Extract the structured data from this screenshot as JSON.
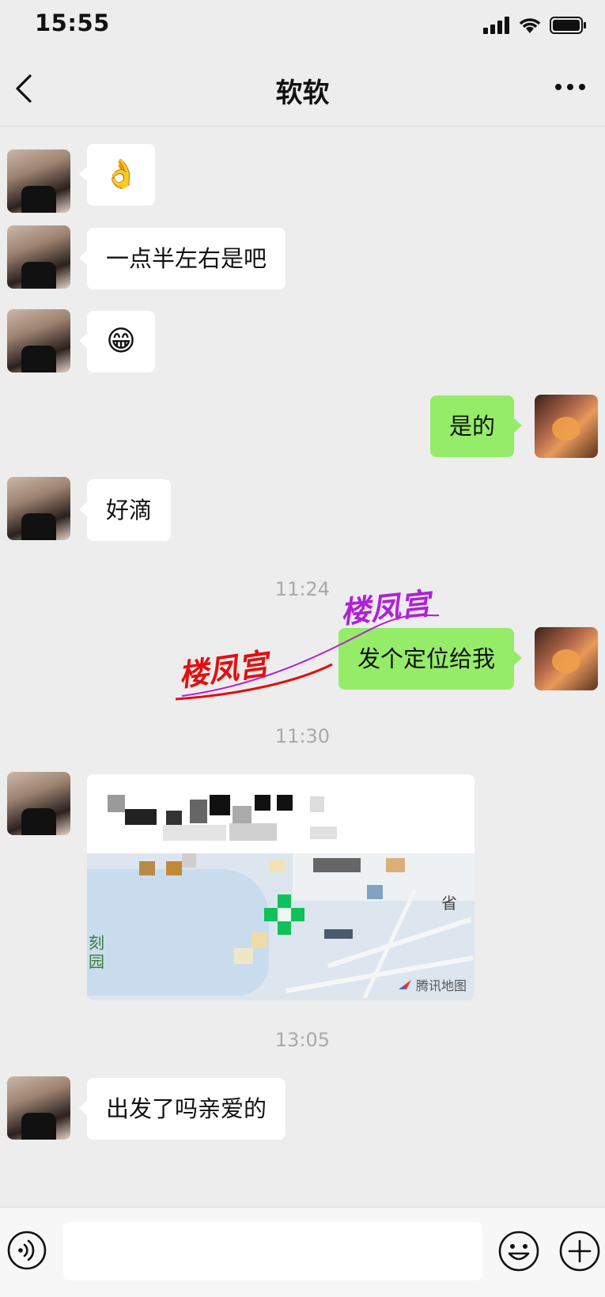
{
  "status_bar": {
    "time": "15:55"
  },
  "header": {
    "title": "软软"
  },
  "messages": [
    {
      "side": "left",
      "kind": "emoji",
      "text": "👌"
    },
    {
      "side": "left",
      "kind": "text",
      "text": "一点半左右是吧"
    },
    {
      "side": "left",
      "kind": "emoji",
      "text": "😁"
    },
    {
      "side": "right",
      "kind": "text",
      "text": "是的"
    },
    {
      "side": "left",
      "kind": "text",
      "text": "好滴"
    },
    {
      "kind": "timestamp",
      "text": "11:24"
    },
    {
      "side": "right",
      "kind": "text",
      "text": "发个定位给我"
    },
    {
      "kind": "timestamp",
      "text": "11:30"
    },
    {
      "side": "left",
      "kind": "location",
      "map_labels": [
        "刻",
        "园"
      ],
      "map_side_label": "省",
      "map_brand": "腾讯地图"
    },
    {
      "kind": "timestamp",
      "text": "13:05"
    },
    {
      "side": "left",
      "kind": "text",
      "text": "出发了吗亲爱的"
    }
  ],
  "watermark": {
    "text_red": "楼凤宫",
    "text_purple": "楼凤宫",
    "color_red": "#e01010",
    "color_purple": "#b020d8"
  },
  "input": {
    "value": "",
    "placeholder": ""
  },
  "colors": {
    "bubble_self": "#95ec69",
    "bubble_other": "#ffffff",
    "background": "#ededed"
  },
  "icons": {
    "back": "chevron-left-icon",
    "more": "more-dots-icon",
    "voice": "voice-icon",
    "emoji": "emoji-icon",
    "plus": "plus-icon"
  }
}
